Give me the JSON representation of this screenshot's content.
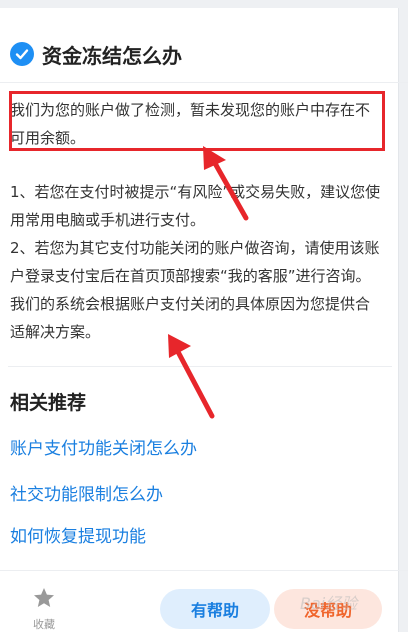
{
  "article": {
    "title": "资金冻结怎么办",
    "note": "我们为您的账户做了检测，暂未发现您的账户中存在不可用余额。",
    "paragraphs": [
      "1、若您在支付时被提示“有风险”或交易失败，建议您使用常用电脑或手机进行支付。",
      "2、若您为其它支付功能关闭的账户做咨询，请使用该账户登录支付宝后在首页顶部搜索“我的客服”进行咨询。我们的系统会根据账户支付关闭的具体原因为您提供合适解决方案。"
    ]
  },
  "recommend": {
    "title": "相关推荐",
    "links": [
      "账户支付功能关闭怎么办",
      "社交功能限制怎么办",
      "如何恢复提现功能"
    ]
  },
  "footer": {
    "favorite_label": "收藏",
    "helpful_label": "有帮助",
    "unhelpful_label": "没帮助",
    "watermark": "Bai经验"
  },
  "colors": {
    "accent": "#1a7fe0",
    "highlight": "#e7262b",
    "unhelpful": "#f0652c"
  }
}
